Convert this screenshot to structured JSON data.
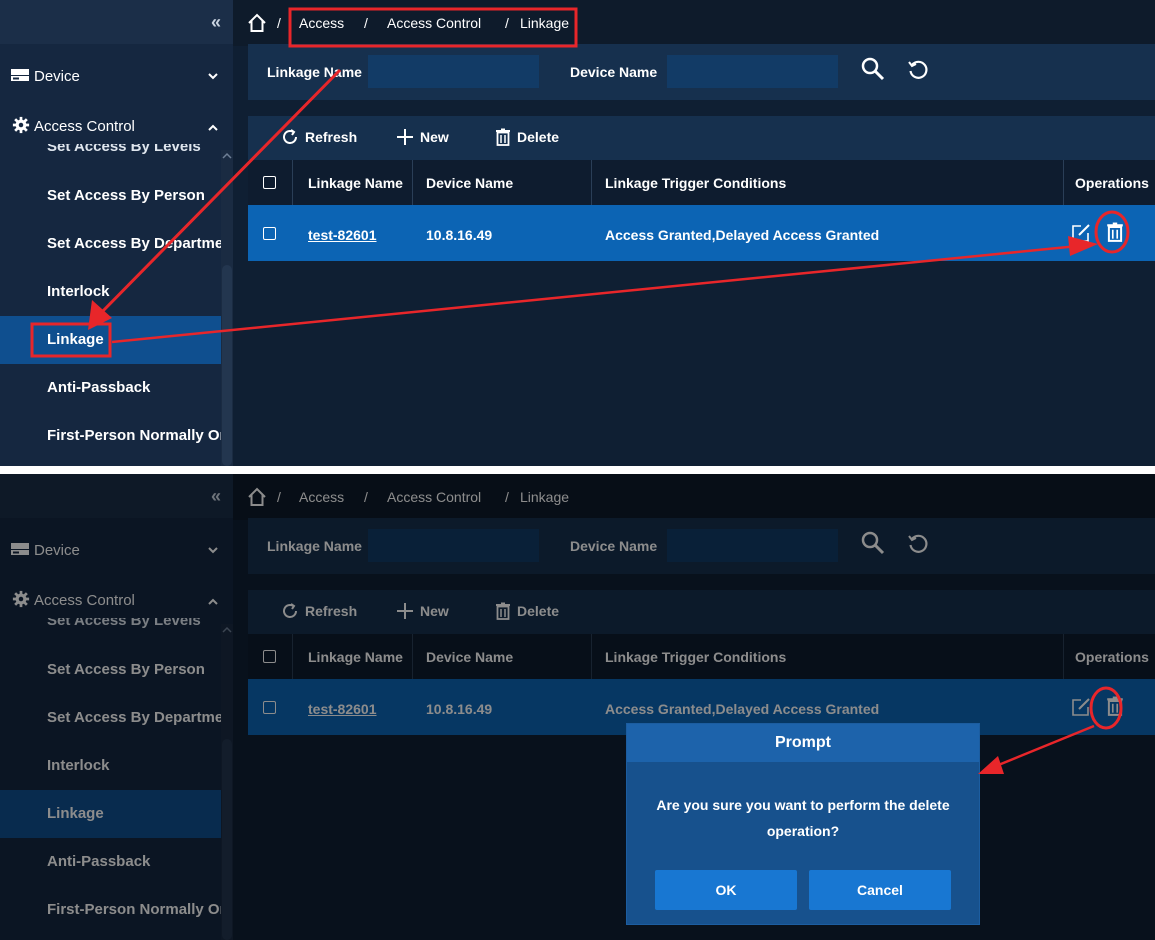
{
  "sidebar": {
    "collapse_icon": "«",
    "groups": [
      {
        "label": "Device",
        "icon": "device-icon",
        "chevron": "⌄"
      },
      {
        "label": "Access Control",
        "icon": "gear-icon",
        "chevron": "˄"
      }
    ],
    "partial_item": "Set Access By Levels",
    "items": [
      {
        "label": "Set Access By Person"
      },
      {
        "label": "Set Access By Departme"
      },
      {
        "label": "Interlock"
      },
      {
        "label": "Linkage"
      },
      {
        "label": "Anti-Passback"
      },
      {
        "label": "First-Person Normally Oı"
      }
    ]
  },
  "breadcrumb": {
    "sep": "/",
    "items": [
      "Access",
      "Access Control",
      "Linkage"
    ]
  },
  "filter": {
    "linkage_name_label": "Linkage Name",
    "device_name_label": "Device Name",
    "linkage_name_value": "",
    "device_name_value": ""
  },
  "toolbar": {
    "refresh": "Refresh",
    "new": "New",
    "delete": "Delete"
  },
  "table": {
    "headers": [
      "Linkage Name",
      "Device Name",
      "Linkage Trigger Conditions",
      "Operations"
    ],
    "rows": [
      {
        "linkage_name": "test-82601",
        "device_name": "10.8.16.49",
        "conditions": "Access Granted,Delayed Access Granted"
      }
    ]
  },
  "dialog": {
    "title": "Prompt",
    "message": "Are you sure you want to perform the delete operation?",
    "ok": "OK",
    "cancel": "Cancel"
  },
  "colors": {
    "annotation": "#e8262a",
    "selected_row": "#0c64b4",
    "active_nav": "#0f4f8f",
    "dialog": "#17518d",
    "dialog_button": "#1877d2"
  }
}
